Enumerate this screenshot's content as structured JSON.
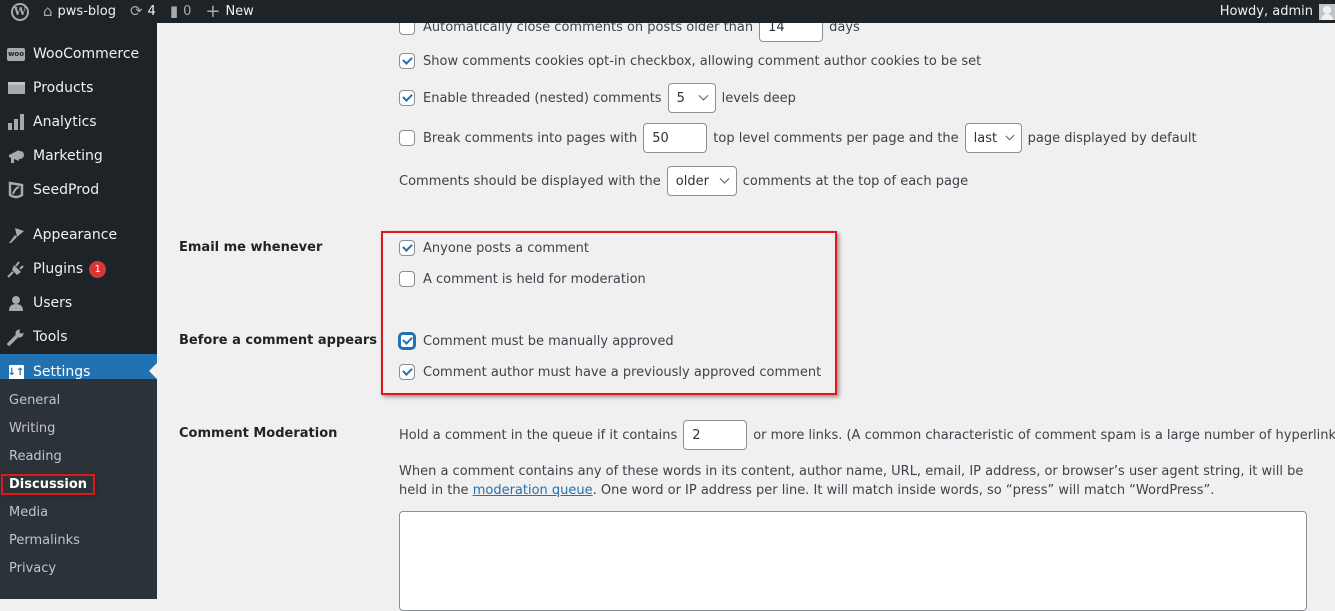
{
  "adminbar": {
    "site_name": "pws-blog",
    "updates_count": "4",
    "comments_count": "0",
    "new_label": "New",
    "greeting": "Howdy, admin"
  },
  "sidebar": {
    "items": [
      {
        "label": "WooCommerce",
        "icon": "woocommerce-icon"
      },
      {
        "label": "Products",
        "icon": "archive-icon"
      },
      {
        "label": "Analytics",
        "icon": "bar-chart-icon"
      },
      {
        "label": "Marketing",
        "icon": "megaphone-icon"
      },
      {
        "label": "SeedProd",
        "icon": "leaf-icon"
      },
      {
        "label": "Appearance",
        "icon": "paintbrush-icon"
      },
      {
        "label": "Plugins",
        "icon": "plug-icon",
        "badge": "1"
      },
      {
        "label": "Users",
        "icon": "user-icon"
      },
      {
        "label": "Tools",
        "icon": "wrench-icon"
      },
      {
        "label": "Settings",
        "icon": "settings-icon",
        "current": true
      }
    ],
    "submenu": [
      {
        "label": "General"
      },
      {
        "label": "Writing"
      },
      {
        "label": "Reading"
      },
      {
        "label": "Discussion",
        "current": true
      },
      {
        "label": "Media"
      },
      {
        "label": "Permalinks"
      },
      {
        "label": "Privacy"
      }
    ]
  },
  "main": {
    "auto_close": {
      "checked": false,
      "label": "Automatically close comments on posts older than",
      "value": "14",
      "suffix": "days"
    },
    "cookies_optin": {
      "checked": true,
      "label": "Show comments cookies opt-in checkbox, allowing comment author cookies to be set"
    },
    "threaded": {
      "checked": true,
      "label": "Enable threaded (nested) comments",
      "value": "5",
      "suffix": "levels deep"
    },
    "paged": {
      "checked": false,
      "label": "Break comments into pages with",
      "value": "50",
      "middle": "top level comments per page and the",
      "select": "last",
      "suffix": "page displayed by default"
    },
    "order": {
      "label": "Comments should be displayed with the",
      "select": "older",
      "suffix": "comments at the top of each page"
    },
    "email_me": {
      "heading": "Email me whenever",
      "options": [
        {
          "label": "Anyone posts a comment",
          "checked": true
        },
        {
          "label": "A comment is held for moderation",
          "checked": false
        }
      ]
    },
    "before_appears": {
      "heading": "Before a comment appears",
      "options": [
        {
          "label": "Comment must be manually approved",
          "checked": true
        },
        {
          "label": "Comment author must have a previously approved comment",
          "checked": true
        }
      ]
    },
    "moderation": {
      "heading": "Comment Moderation",
      "hold_prefix": "Hold a comment in the queue if it contains",
      "links_value": "2",
      "hold_suffix": "or more links. (A common characteristic of comment spam is a large number of hyperlinks.)",
      "desc_line1": "When a comment contains any of these words in its content, author name, URL, email, IP address, or browser’s user agent string, it will be held in the",
      "desc_link": "moderation queue",
      "desc_line2": ". One word or IP address per line. It will match inside words, so “press” will match “WordPress”.",
      "keys_value": ""
    }
  },
  "colors": {
    "accent": "#2271b1",
    "admin_bg": "#1d2327",
    "highlight_red": "#e0171b",
    "badge_red": "#d63638"
  }
}
